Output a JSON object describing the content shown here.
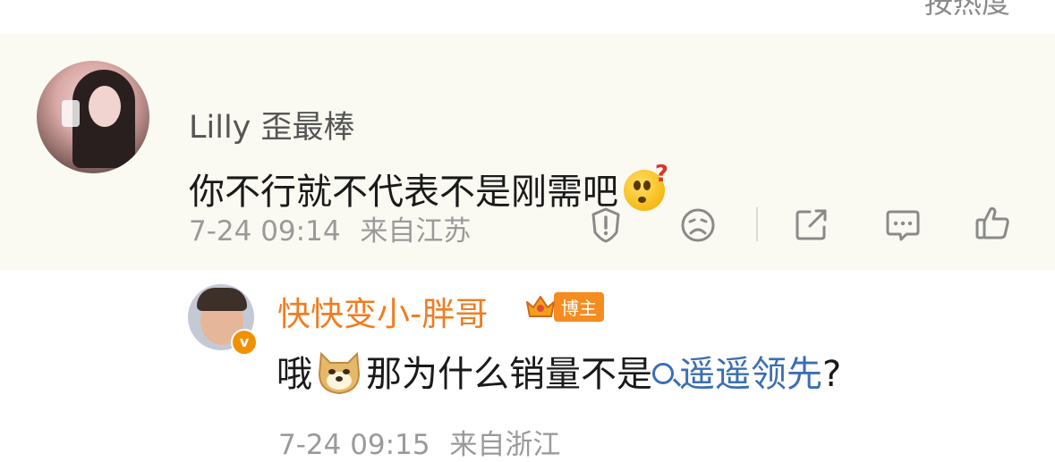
{
  "top_sort_label": "按热度",
  "comment": {
    "username": "Lilly 歪最棒",
    "text": "你不行就不代表不是刚需吧",
    "emoji": "confused-emoji",
    "time": "7-24 09:14",
    "location": "来自江苏",
    "actions": [
      "report-icon",
      "dislike-icon",
      "share-icon",
      "comment-icon",
      "like-icon"
    ]
  },
  "reply": {
    "username": "快快变小-胖哥",
    "badge_label": "博主",
    "verified_symbol": "v",
    "text_before": "哦",
    "text_after": "那为什么销量不是",
    "topic": "遥遥领先",
    "text_end": "?",
    "emoji": "doge-emoji",
    "time": "7-24 09:15",
    "location": "来自浙江"
  },
  "colors": {
    "highlight_bg": "#fbfaf2",
    "blogger_orange": "#f07d20",
    "link_blue": "#3b6fb2",
    "meta_gray": "#9a9a9a"
  }
}
